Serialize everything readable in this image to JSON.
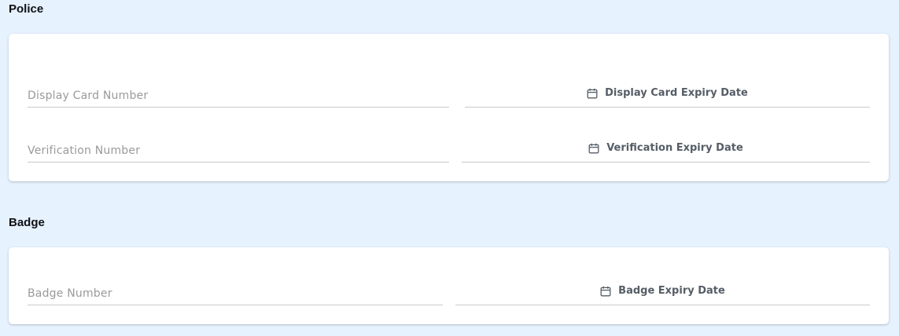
{
  "police": {
    "title": "Police",
    "display_card_number": {
      "placeholder": "Display Card Number",
      "value": ""
    },
    "display_card_expiry": {
      "label": "Display Card Expiry Date",
      "icon": "calendar-icon"
    },
    "verification_number": {
      "placeholder": "Verification Number",
      "value": ""
    },
    "verification_expiry": {
      "label": "Verification Expiry Date",
      "icon": "calendar-icon"
    }
  },
  "badge": {
    "title": "Badge",
    "badge_number": {
      "placeholder": "Badge Number",
      "value": ""
    },
    "badge_expiry": {
      "label": "Badge Expiry Date",
      "icon": "calendar-icon"
    }
  },
  "colors": {
    "background": "#e6f2fe",
    "card": "#ffffff",
    "underline": "#c9c9c9",
    "placeholder": "#9a9a9a",
    "date_label": "#555d66"
  }
}
